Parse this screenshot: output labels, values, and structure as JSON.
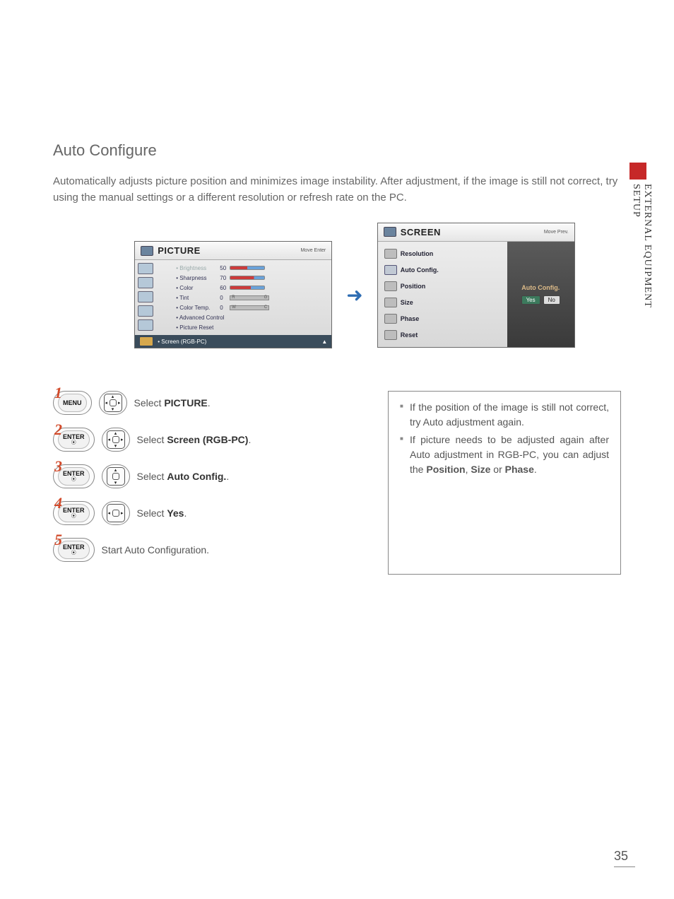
{
  "section": {
    "title": "Auto Configure",
    "intro": "Automatically adjusts picture position and minimizes image instability. After adjustment, if the image is still not correct, try using the manual settings or a different resolution or refresh rate on the PC."
  },
  "side_tab": "EXTERNAL EQUIPMENT SETUP",
  "picture_menu": {
    "title": "PICTURE",
    "hints": "Move    Enter",
    "items": [
      {
        "label": "• Brightness",
        "value": "50",
        "dim": true,
        "slider": true
      },
      {
        "label": "• Sharpness",
        "value": "70",
        "slider": true
      },
      {
        "label": "• Color",
        "value": "60",
        "slider": true
      },
      {
        "label": "• Tint",
        "value": "0",
        "tint": true
      },
      {
        "label": "• Color Temp.",
        "value": "0",
        "tint": true
      },
      {
        "label": "• Advanced Control"
      },
      {
        "label": "• Picture Reset"
      }
    ],
    "footer": "• Screen (RGB-PC)"
  },
  "screen_menu": {
    "title": "SCREEN",
    "hints": "Move    Prev.",
    "items": [
      {
        "name": "Resolution"
      },
      {
        "name": "Auto Config.",
        "sel": true
      },
      {
        "name": "Position"
      },
      {
        "name": "Size"
      },
      {
        "name": "Phase"
      },
      {
        "name": "Reset"
      }
    ],
    "right_label": "Auto Config.",
    "yes": "Yes",
    "no": "No"
  },
  "steps": [
    {
      "n": "1",
      "btn": "MENU",
      "dpad": "full",
      "text_pre": "Select ",
      "bold": "PICTURE",
      "text_post": "."
    },
    {
      "n": "2",
      "btn": "ENTER",
      "dpad": "full",
      "text_pre": "Select ",
      "bold": "Screen (RGB-PC)",
      "text_post": "."
    },
    {
      "n": "3",
      "btn": "ENTER",
      "dpad": "ud",
      "text_pre": "Select ",
      "bold": "Auto Config.",
      "text_post": "."
    },
    {
      "n": "4",
      "btn": "ENTER",
      "dpad": "lr",
      "text_pre": "Select ",
      "bold": "Yes",
      "text_post": "."
    },
    {
      "n": "5",
      "btn": "ENTER",
      "dpad": null,
      "text_pre": "Start Auto Configuration.",
      "bold": "",
      "text_post": ""
    }
  ],
  "notes": {
    "n1_a": "If the position of the image is still not correct, try Auto adjustment again.",
    "n2_a": "If picture needs to be adjusted again after Auto adjustment in RGB-PC, you can adjust the ",
    "n2_b1": "Position",
    "n2_b2": "Size",
    "n2_b3": "Phase",
    "n2_sep1": ", ",
    "n2_sep2": " or ",
    "n2_end": "."
  },
  "page_number": "35"
}
